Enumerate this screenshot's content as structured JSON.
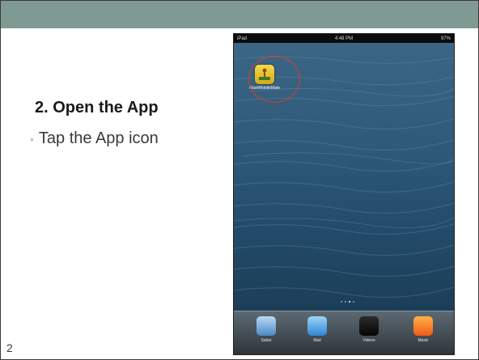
{
  "slide": {
    "title": "2. Open the App",
    "bullet": "Tap the App icon",
    "page_number": "2"
  },
  "device": {
    "status_left": "iPad",
    "status_time": "4:48 PM",
    "status_right": "97%",
    "app_label": "FlashMobileMate",
    "dock": [
      {
        "label": "Safari",
        "icon": "safari-icon"
      },
      {
        "label": "Mail",
        "icon": "mail-icon"
      },
      {
        "label": "Videos",
        "icon": "videos-icon"
      },
      {
        "label": "Music",
        "icon": "music-icon"
      }
    ]
  },
  "colors": {
    "header_band": "#7f9a93",
    "highlight_circle": "#e23a2f"
  }
}
